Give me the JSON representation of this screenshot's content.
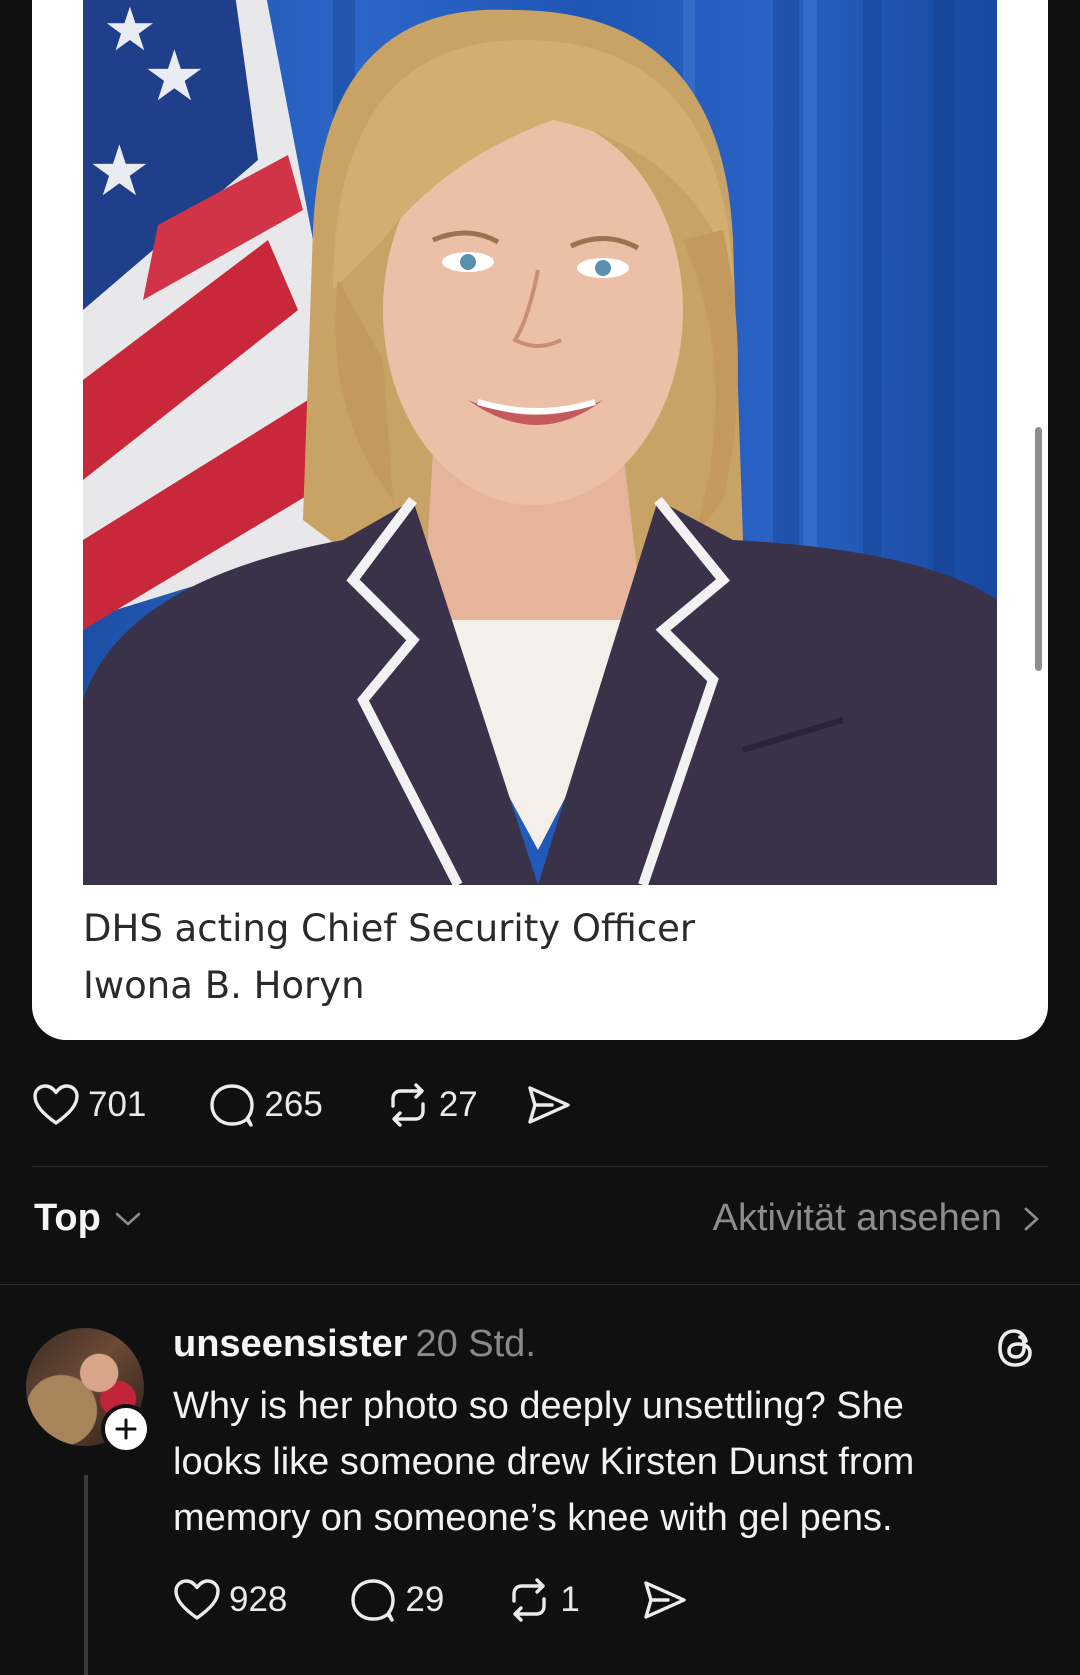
{
  "post": {
    "image_caption_line1": "DHS acting Chief Security Officer",
    "image_caption_line2": "Iwona B. Horyn",
    "likes": "701",
    "replies": "265",
    "reposts": "27"
  },
  "replies_header": {
    "sort_label": "Top",
    "activity_link": "Aktivität ansehen"
  },
  "comment": {
    "username": "unseensister",
    "time": "20 Std.",
    "text_line1": "Why is her photo so deeply unsettling? She",
    "text_line2": "looks like someone drew Kirsten Dunst from",
    "text_line3": "memory on someone’s knee with gel pens.",
    "likes": "928",
    "replies": "29",
    "reposts": "1"
  },
  "icons": {
    "like": "heart-icon",
    "reply": "speech-bubble-icon",
    "repost": "repost-arrows-icon",
    "share": "send-icon",
    "threads": "threads-logo-icon",
    "follow": "plus-icon"
  },
  "colors": {
    "background": "#101010",
    "text": "#f3f3f3",
    "muted": "#8c8c8c",
    "card": "#ffffff",
    "backdrop_blue": "#2c66c8"
  }
}
